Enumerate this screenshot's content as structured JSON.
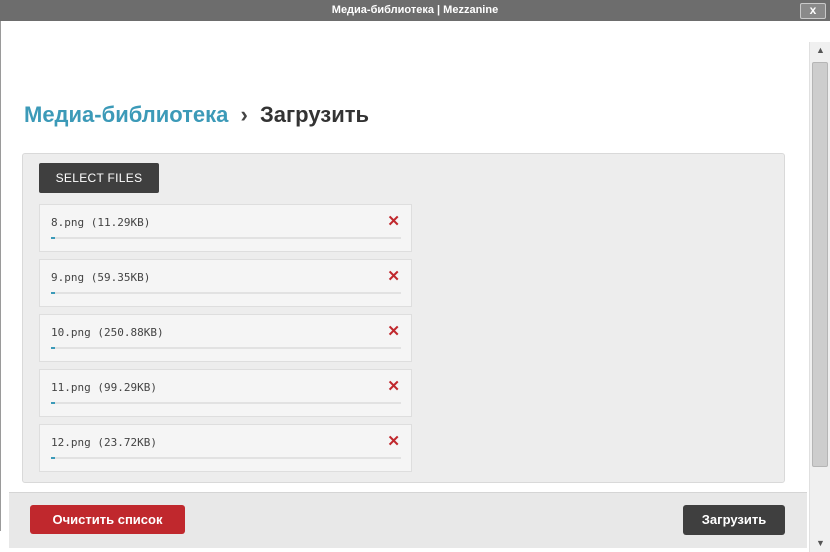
{
  "window": {
    "title": "Медиа-библиотека | Mezzanine",
    "close_label": "x"
  },
  "header": {
    "crumb": "Медиа-библиотека",
    "separator": "›",
    "current": "Загрузить"
  },
  "uploader": {
    "select_label": "SELECT FILES",
    "files": [
      {
        "name": "8.png (11.29KB)",
        "progress": 0.01
      },
      {
        "name": "9.png (59.35KB)",
        "progress": 0.01
      },
      {
        "name": "10.png (250.88KB)",
        "progress": 0.01
      },
      {
        "name": "11.png (99.29KB)",
        "progress": 0.01
      },
      {
        "name": "12.png (23.72KB)",
        "progress": 0.01
      }
    ],
    "remove_glyph": "✕"
  },
  "footer": {
    "clear_label": "Очистить список",
    "upload_label": "Загрузить"
  },
  "icons": {
    "scroll_up": "▲",
    "scroll_down": "▼"
  },
  "colors": {
    "accent": "#3c9ab8",
    "danger": "#c0282d",
    "dark_button": "#3f3f3f"
  }
}
